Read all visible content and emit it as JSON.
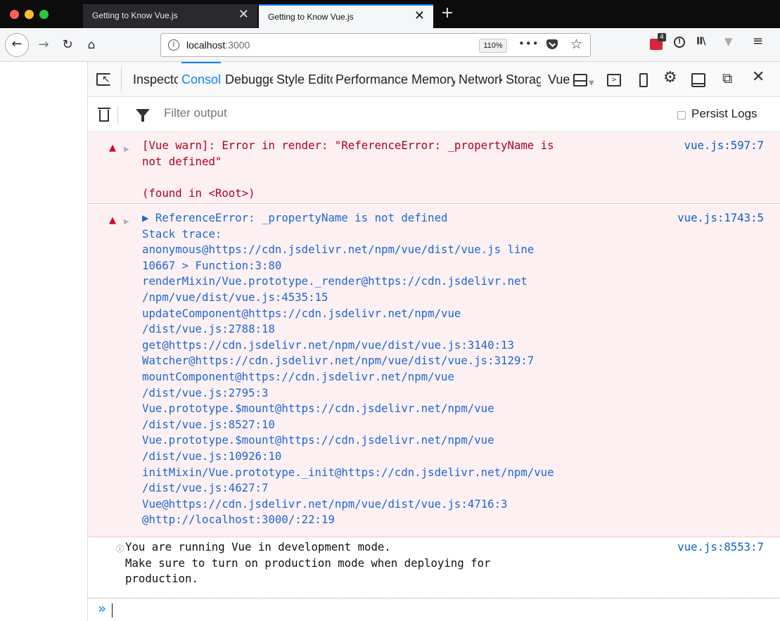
{
  "browser": {
    "tabs": [
      {
        "title": "Getting to Know Vue.js",
        "active": false
      },
      {
        "title": "Getting to Know Vue.js",
        "active": true
      }
    ],
    "tab_close_glyph": "✕",
    "new_tab_glyph": "+",
    "url_host": "localhost",
    "url_port": ":3000",
    "zoom": "110%",
    "page_actions": "•••",
    "extension_badge": "4"
  },
  "devtools": {
    "tabs": [
      "Inspector",
      "Console",
      "Debugger",
      "Style Editor",
      "Performance",
      "Memory",
      "Network",
      "Storage",
      "Vue"
    ],
    "active_tab": "Console",
    "filter_placeholder": "Filter output",
    "persist_logs_label": "Persist Logs",
    "persist_logs_checked": false,
    "colors": {
      "accent": "#0a84ff",
      "error_bg": "#fdf0f2",
      "error_text": "#b00020",
      "link": "#0a5ec7"
    }
  },
  "console": {
    "messages": [
      {
        "level": "error",
        "text": "[Vue warn]: Error in render: \"ReferenceError: _propertyName is\nnot defined\"\n\n(found in <Root>)",
        "location": "vue.js:597:7"
      },
      {
        "level": "error",
        "text": "▶ ReferenceError: _propertyName is not defined\nStack trace:\nanonymous@https://cdn.jsdelivr.net/npm/vue/dist/vue.js line\n10667 > Function:3:80\nrenderMixin/Vue.prototype._render@https://cdn.jsdelivr.net\n/npm/vue/dist/vue.js:4535:15\nupdateComponent@https://cdn.jsdelivr.net/npm/vue\n/dist/vue.js:2788:18\nget@https://cdn.jsdelivr.net/npm/vue/dist/vue.js:3140:13\nWatcher@https://cdn.jsdelivr.net/npm/vue/dist/vue.js:3129:7\nmountComponent@https://cdn.jsdelivr.net/npm/vue\n/dist/vue.js:2795:3\nVue.prototype.$mount@https://cdn.jsdelivr.net/npm/vue\n/dist/vue.js:8527:10\nVue.prototype.$mount@https://cdn.jsdelivr.net/npm/vue\n/dist/vue.js:10926:10\ninitMixin/Vue.prototype._init@https://cdn.jsdelivr.net/npm/vue\n/dist/vue.js:4627:7\nVue@https://cdn.jsdelivr.net/npm/vue/dist/vue.js:4716:3\n@http://localhost:3000/:22:19",
        "location": "vue.js:1743:5"
      },
      {
        "level": "info",
        "text": "You are running Vue in development mode.\nMake sure to turn on production mode when deploying for\nproduction.",
        "location": "vue.js:8553:7"
      }
    ],
    "prompt": "»"
  }
}
